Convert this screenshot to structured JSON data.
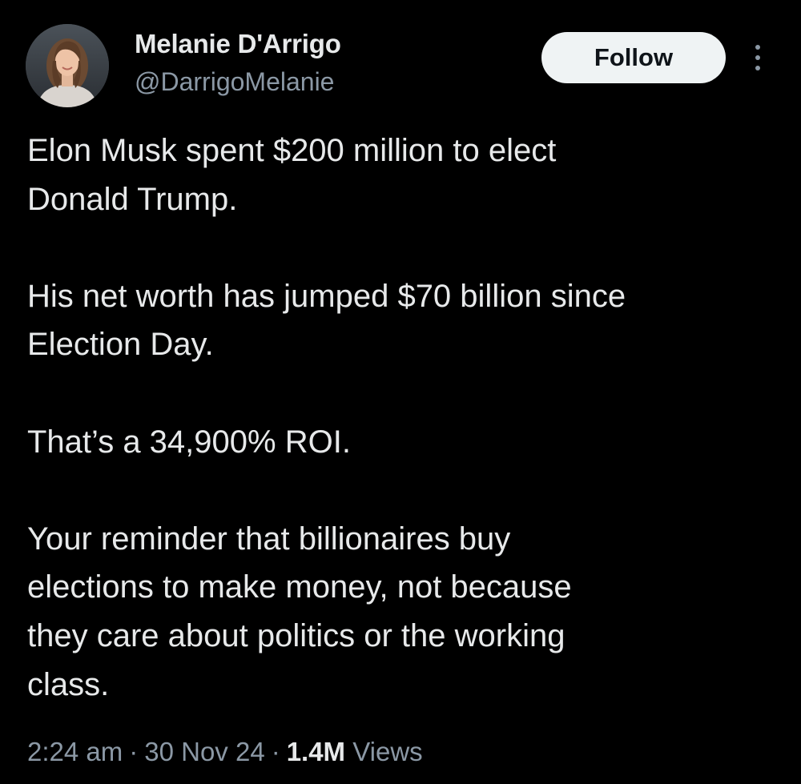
{
  "author": {
    "name": "Melanie D'Arrigo",
    "handle": "@DarrigoMelanie",
    "avatar_icon": "profile-photo"
  },
  "actions": {
    "follow_label": "Follow",
    "more_icon": "more-vertical-icon"
  },
  "tweet": {
    "paragraphs": [
      [
        "Elon Musk spent $200 million to elect",
        "Donald Trump."
      ],
      [
        "His net worth has jumped $70 billion since",
        "Election Day."
      ],
      [
        "That’s a 34,900% ROI."
      ],
      [
        "Your reminder that billionaires buy",
        "elections to make money, not because",
        "they care about politics or the working",
        "class."
      ]
    ]
  },
  "meta": {
    "time": "2:24 am",
    "separator": "·",
    "date": "30 Nov 24",
    "views_count": "1.4M",
    "views_label": "Views"
  },
  "colors": {
    "background": "#000000",
    "primary_text": "#e7e9ea",
    "secondary_text": "#8b98a5",
    "follow_bg": "#eff3f4",
    "follow_text": "#0f1419"
  }
}
